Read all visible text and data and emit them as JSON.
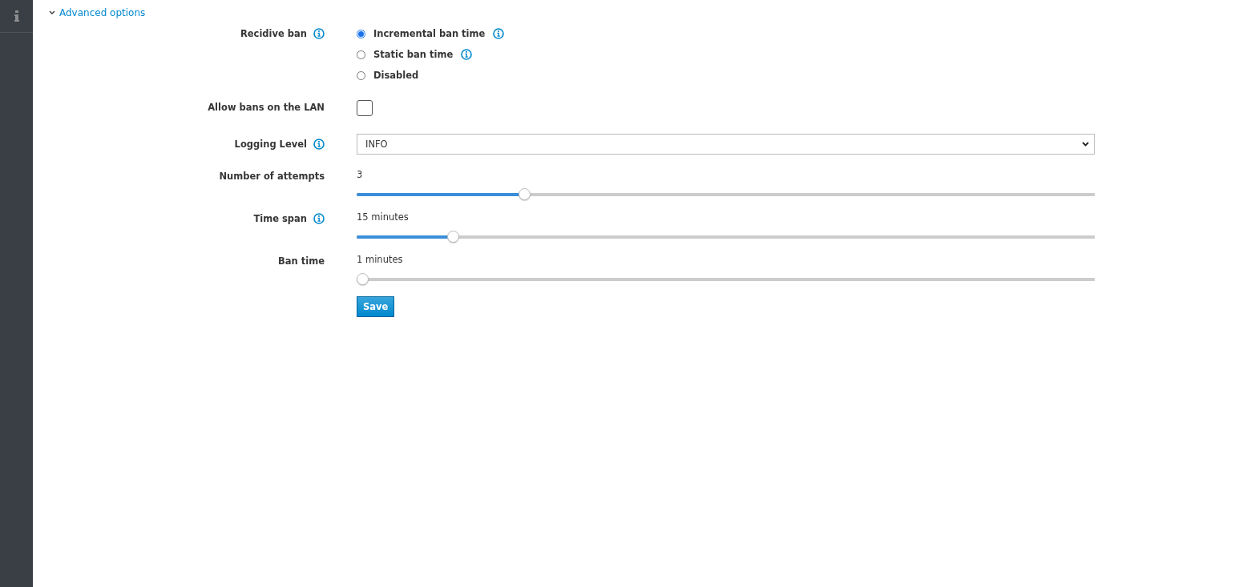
{
  "section": {
    "title": "Advanced options",
    "expanded": true
  },
  "rows": [
    {
      "kind": "radio",
      "label": "Recidive ban",
      "info": true,
      "options": [
        {
          "label": "Incremental ban time",
          "info": true,
          "selected": true
        },
        {
          "label": "Static ban time",
          "info": true,
          "selected": false
        },
        {
          "label": "Disabled",
          "info": false,
          "selected": false
        }
      ]
    },
    {
      "kind": "checkbox",
      "label": "Allow bans on the LAN",
      "info": false,
      "checked": false
    },
    {
      "kind": "select",
      "label": "Logging Level",
      "info": true,
      "value": "INFO"
    },
    {
      "kind": "slider",
      "label": "Number of attempts",
      "info": false,
      "reading": "3",
      "level": 0.223
    },
    {
      "kind": "slider",
      "label": "Time span",
      "info": true,
      "reading": "15 minutes",
      "level": 0.125
    },
    {
      "kind": "slider",
      "label": "Ban time",
      "info": false,
      "reading": "1 minutes",
      "level": 0
    }
  ],
  "save_button": "Save"
}
